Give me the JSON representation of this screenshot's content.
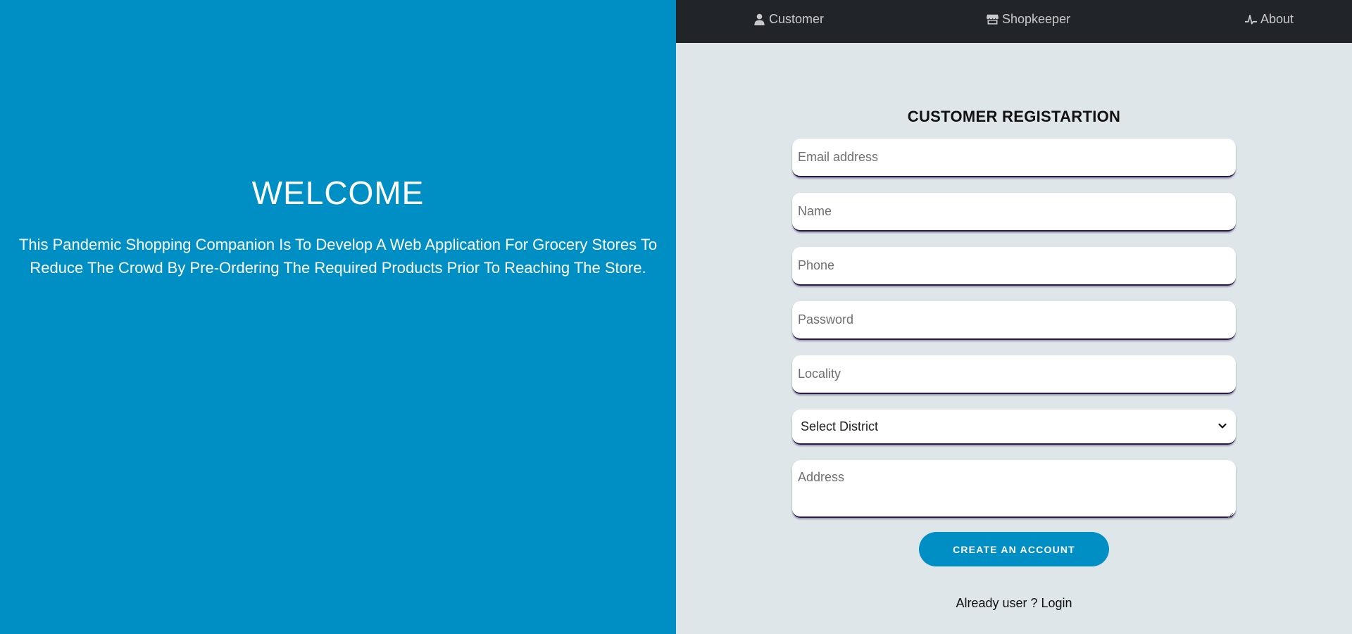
{
  "welcome": {
    "title": "WELCOME",
    "description": "This Pandemic Shopping Companion Is To Develop A Web Application For Grocery Stores To Reduce The Crowd By Pre-Ordering The Required Products Prior To Reaching The Store."
  },
  "nav": {
    "items": [
      {
        "label": "Customer",
        "icon": "user-icon"
      },
      {
        "label": "Shopkeeper",
        "icon": "store-icon"
      },
      {
        "label": "About",
        "icon": "pulse-icon"
      }
    ]
  },
  "form": {
    "title": "CUSTOMER REGISTARTION",
    "email_placeholder": "Email address",
    "name_placeholder": "Name",
    "phone_placeholder": "Phone",
    "password_placeholder": "Password",
    "locality_placeholder": "Locality",
    "district_selected": "Select District",
    "address_placeholder": "Address",
    "submit_label": "CREATE AN ACCOUNT",
    "login_prompt": "Already user ?",
    "login_label": "Login"
  },
  "colors": {
    "brand_blue": "#008fc5",
    "navbar": "#212529",
    "panel_bg": "#dfe6e9"
  }
}
